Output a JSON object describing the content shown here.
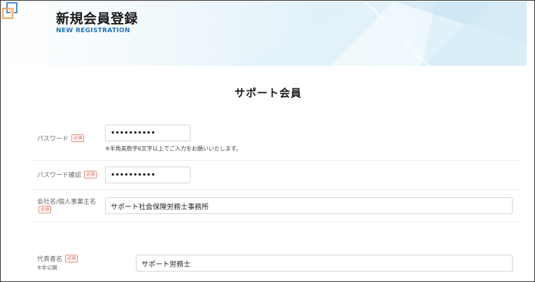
{
  "header": {
    "title": "新規会員登録",
    "subtitle": "NEW REGISTRATION"
  },
  "section": {
    "title": "サポート会員"
  },
  "required_badge": "必須",
  "form": {
    "password": {
      "label": "パスワード",
      "value": "••••••••••",
      "help": "※半角英数字6文字以上でご入力をお願いいたします。"
    },
    "password_confirm": {
      "label": "パスワード確認",
      "value": "••••••••••"
    },
    "company": {
      "label": "会社名/個人事業主名",
      "value": "サポート社会保険労務士事務所"
    },
    "representative": {
      "label": "代表者名",
      "note": "※非公開",
      "value": "サポート労務士"
    }
  },
  "colors": {
    "accent_blue": "#1e73be",
    "required_red": "#e0533d",
    "logo_orange": "#f0a35e",
    "logo_blue": "#4a8fd1"
  }
}
